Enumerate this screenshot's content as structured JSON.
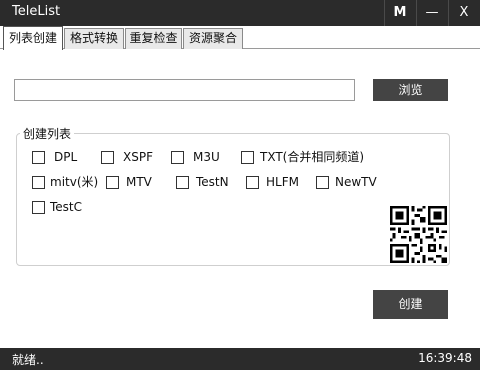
{
  "window": {
    "title": "TeleList",
    "buttons": {
      "m": "M",
      "minimize": "—",
      "close": "X"
    }
  },
  "tabs": [
    {
      "label": "列表创建",
      "active": true
    },
    {
      "label": "格式转换",
      "active": false
    },
    {
      "label": "重复检查",
      "active": false
    },
    {
      "label": "资源聚合",
      "active": false
    }
  ],
  "path": {
    "value": "",
    "placeholder": ""
  },
  "browse_label": "浏览",
  "group": {
    "legend": "创建列表",
    "options": [
      {
        "label": "DPL",
        "checked": false
      },
      {
        "label": "XSPF",
        "checked": false
      },
      {
        "label": "M3U",
        "checked": false
      },
      {
        "label": "TXT(合并相同频道)",
        "checked": false
      },
      {
        "label": "mitv(米)",
        "checked": false
      },
      {
        "label": "MTV",
        "checked": false
      },
      {
        "label": "TestN",
        "checked": false
      },
      {
        "label": "HLFM",
        "checked": false
      },
      {
        "label": "NewTV",
        "checked": false
      },
      {
        "label": "TestC",
        "checked": false
      }
    ],
    "qr_icon": "qr-code"
  },
  "create_label": "创建",
  "status": {
    "text": "就绪..",
    "time": "16:39:48"
  },
  "colors": {
    "titlebar": "#2b2b2b",
    "button": "#444444",
    "statusbar": "#2b2b2b"
  }
}
